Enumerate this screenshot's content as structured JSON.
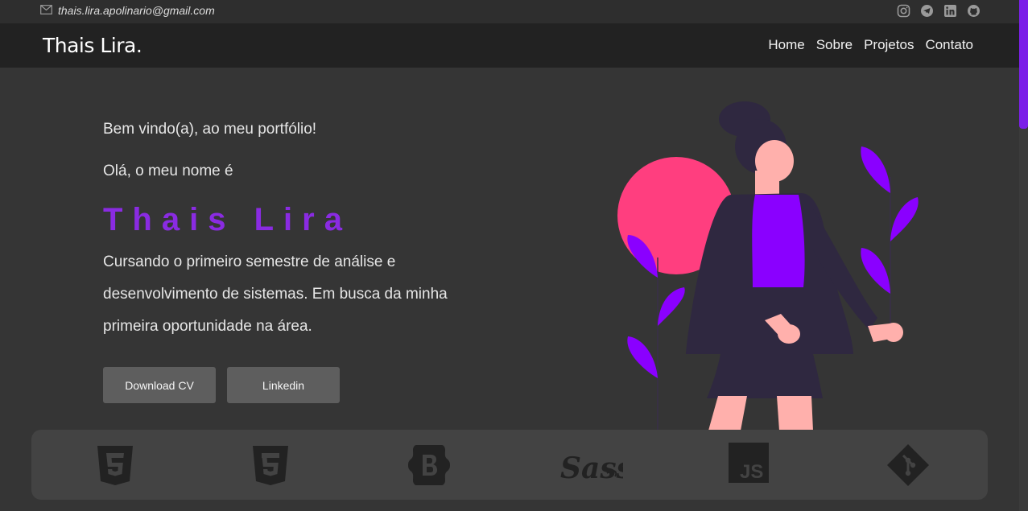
{
  "topbar": {
    "email": "thais.lira.apolinario@gmail.com",
    "socials": [
      "instagram-icon",
      "telegram-icon",
      "linkedin-icon",
      "github-icon"
    ]
  },
  "navbar": {
    "brand": "Thais Lira.",
    "links": [
      "Home",
      "Sobre",
      "Projetos",
      "Contato"
    ]
  },
  "hero": {
    "welcome": "Bem vindo(a), ao meu portfólio!",
    "hello": "Olá, o meu nome é",
    "name": "Thais Lira",
    "description": "Cursando o primeiro semestre de análise e desenvolvimento de sistemas. Em busca da minha primeira oportunidade na área.",
    "buttons": [
      "Download CV",
      "Linkedin"
    ]
  },
  "skills": [
    "html5-icon",
    "css3-icon",
    "bootstrap-icon",
    "sass-icon",
    "javascript-icon",
    "git-icon"
  ],
  "colors": {
    "accent": "#8a2be2",
    "circle": "#ff3e7f",
    "background": "#353535",
    "navbar": "#222222"
  }
}
